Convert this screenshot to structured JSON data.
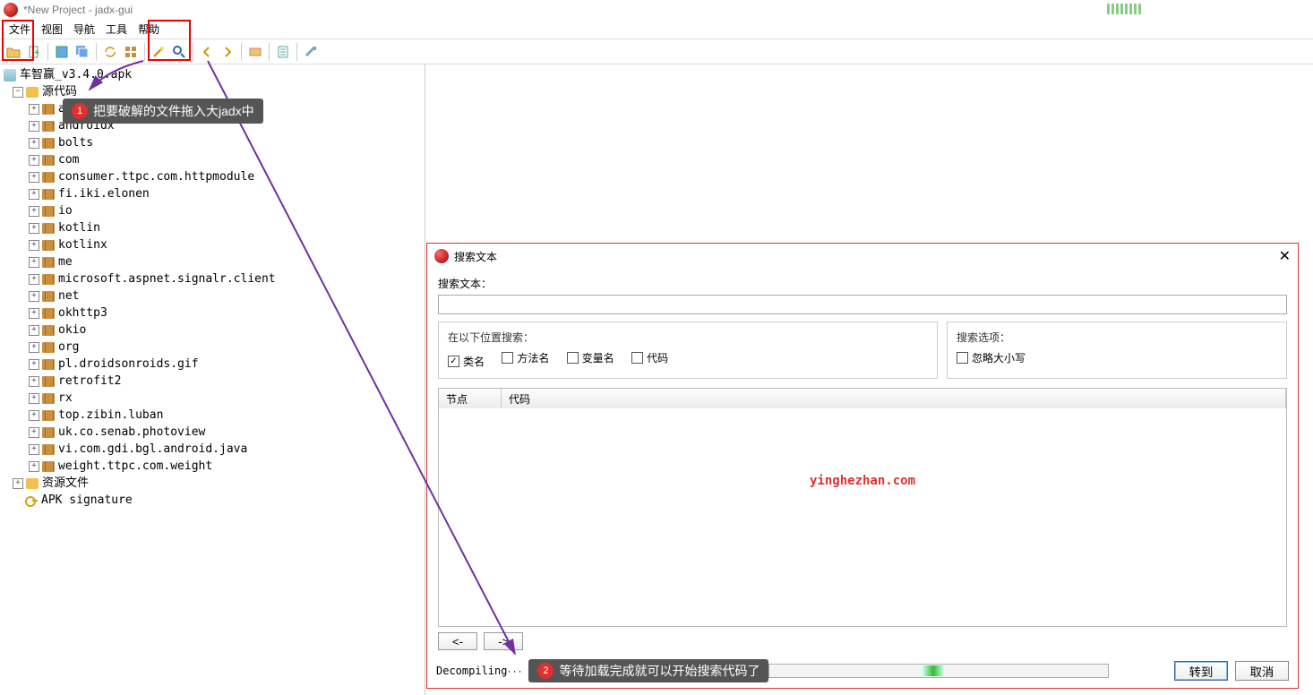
{
  "title": "*New Project - jadx-gui",
  "menus": [
    "文件",
    "视图",
    "导航",
    "工具",
    "帮助"
  ],
  "tree": {
    "root": "车智赢_v3.4.0.apk",
    "src_label": "源代码",
    "packages": [
      "android",
      "androidx",
      "bolts",
      "com",
      "consumer.ttpc.com.httpmodule",
      "fi.iki.elonen",
      "io",
      "kotlin",
      "kotlinx",
      "me",
      "microsoft.aspnet.signalr.client",
      "net",
      "okhttp3",
      "okio",
      "org",
      "pl.droidsonroids.gif",
      "retrofit2",
      "rx",
      "top.zibin.luban",
      "uk.co.senab.photoview",
      "vi.com.gdi.bgl.android.java",
      "weight.ttpc.com.weight"
    ],
    "res_label": "资源文件",
    "sig_label": "APK signature"
  },
  "annotation1": {
    "num": "1",
    "text": "把要破解的文件拖入大jadx中"
  },
  "annotation2": {
    "num": "2",
    "text": "等待加载完成就可以开始搜索代码了"
  },
  "dialog": {
    "title": "搜索文本",
    "input_label": "搜索文本：",
    "where_label": "在以下位置搜索：",
    "options_label": "搜索选项：",
    "chk_class": "类名",
    "chk_method": "方法名",
    "chk_var": "变量名",
    "chk_code": "代码",
    "chk_case": "忽略大小写",
    "col_node": "节点",
    "col_code": "代码",
    "watermark": "yinghezhan.com",
    "nav_prev": "<-",
    "nav_next": "->",
    "status": "Decompiling",
    "btn_go": "转到",
    "btn_cancel": "取消"
  }
}
